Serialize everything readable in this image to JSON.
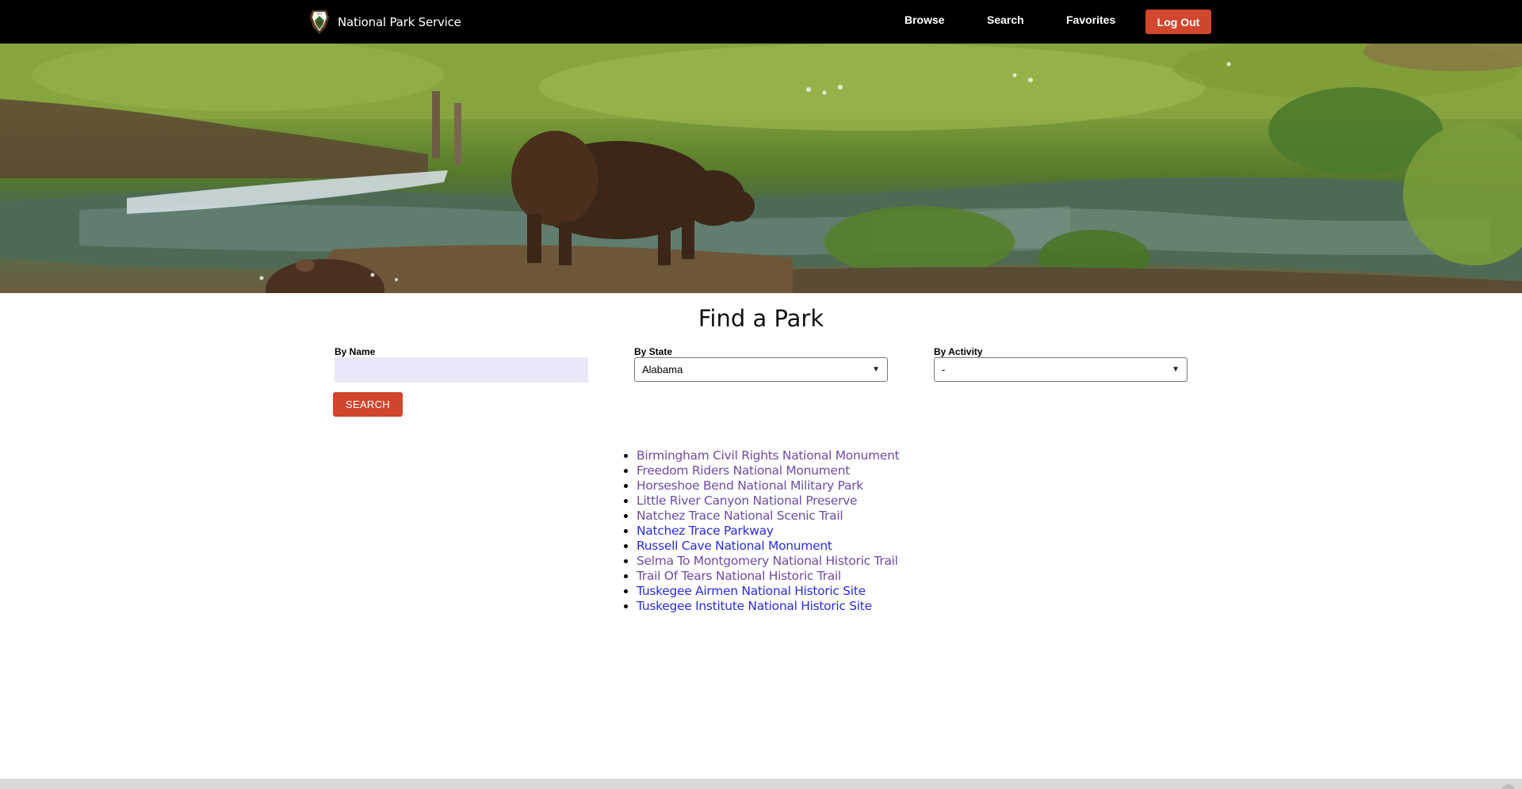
{
  "navbar": {
    "brand": "National Park Service",
    "links": {
      "browse": "Browse",
      "search": "Search",
      "favorites": "Favorites"
    },
    "logout": "Log Out"
  },
  "hero": {
    "icon": "bison-meadow-photo"
  },
  "main": {
    "title": "Find a Park",
    "name_label": "By Name",
    "name_value": "",
    "state_label": "By State",
    "state_value": "Alabama",
    "activity_label": "By Activity",
    "activity_value": "-",
    "search_button": "SEARCH"
  },
  "results": [
    {
      "name": "Birmingham Civil Rights National Monument",
      "visited": true
    },
    {
      "name": "Freedom Riders National Monument",
      "visited": true
    },
    {
      "name": "Horseshoe Bend National Military Park",
      "visited": true
    },
    {
      "name": "Little River Canyon National Preserve",
      "visited": true
    },
    {
      "name": "Natchez Trace National Scenic Trail",
      "visited": true
    },
    {
      "name": "Natchez Trace Parkway",
      "visited": false
    },
    {
      "name": "Russell Cave National Monument",
      "visited": false
    },
    {
      "name": "Selma To Montgomery National Historic Trail",
      "visited": true
    },
    {
      "name": "Trail Of Tears National Historic Trail",
      "visited": true
    },
    {
      "name": "Tuskegee Airmen National Historic Site",
      "visited": false
    },
    {
      "name": "Tuskegee Institute National Historic Site",
      "visited": false
    }
  ],
  "colors": {
    "accent": "#d0472e",
    "visited_link": "#6e4ca3",
    "link": "#2c2cd8",
    "navbar": "#000000"
  }
}
